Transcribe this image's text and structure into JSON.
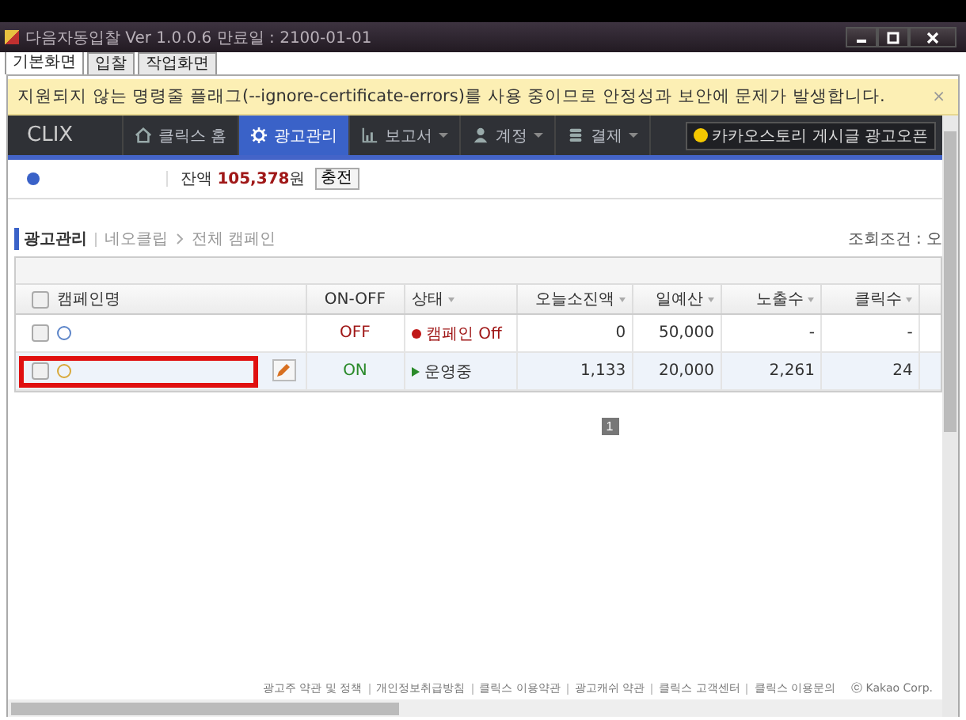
{
  "window": {
    "title": "다음자동입찰 Ver 1.0.0.6 만료일 : 2100-01-01"
  },
  "tabs": [
    {
      "label": "기본화면",
      "selected": true
    },
    {
      "label": "입찰",
      "selected": false
    },
    {
      "label": "작업화면",
      "selected": false
    }
  ],
  "warning": {
    "text": "지원되지 않는 명령줄 플래그(--ignore-certificate-errors)를 사용 중이므로 안정성과 보안에 문제가 발생합니다.",
    "close": "×"
  },
  "nav": {
    "logo": "CLIX",
    "items": [
      {
        "label": "클릭스 홈",
        "dropdown": false,
        "selected": false
      },
      {
        "label": "광고관리",
        "dropdown": false,
        "selected": true
      },
      {
        "label": "보고서",
        "dropdown": true,
        "selected": false
      },
      {
        "label": "계정",
        "dropdown": true,
        "selected": false
      },
      {
        "label": "결제",
        "dropdown": true,
        "selected": false
      }
    ],
    "promo": "카카오스토리 게시글 광고오픈"
  },
  "balance": {
    "text": "잔액 **105,378**원",
    "charge_button": "충전"
  },
  "breadcrumb": [
    "광고관리",
    "네오클립",
    "전체 캠페인"
  ],
  "query_label": "조회조건 : 오",
  "table": {
    "all_checked": false,
    "columns": [
      {
        "label": "캠페인명",
        "sortable": false
      },
      {
        "label": "ON-OFF",
        "sortable": false
      },
      {
        "label": "상태",
        "sortable": true
      },
      {
        "label": "오늘소진액",
        "sortable": true
      },
      {
        "label": "일예산",
        "sortable": true
      },
      {
        "label": "노출수",
        "sortable": true
      },
      {
        "label": "클릭수",
        "sortable": true
      }
    ],
    "rows": [
      {
        "checked": false,
        "selected": false,
        "marked": false,
        "color": "#5b84c8",
        "editable": false,
        "on": false,
        "on_off": "OFF",
        "status": "캠페인 Off",
        "spent": "0",
        "budget": "50,000",
        "impressions": "-",
        "clicks": "-"
      },
      {
        "checked": false,
        "selected": true,
        "marked": true,
        "color": "#d8a838",
        "editable": true,
        "on": true,
        "on_off": "ON",
        "status": "운영중",
        "spent": "1,133",
        "budget": "20,000",
        "impressions": "2,261",
        "clicks": "24"
      }
    ]
  },
  "pagination": [
    {
      "label": "1",
      "selected": true
    }
  ],
  "footer": {
    "links": [
      "광고주 약관 및 정책",
      "개인정보취급방침",
      "클릭스 이용약관",
      "광고캐쉬 약관",
      "클릭스 고객센터",
      "클릭스 이용문의"
    ],
    "copyright": "ⓒ Kakao Corp."
  }
}
